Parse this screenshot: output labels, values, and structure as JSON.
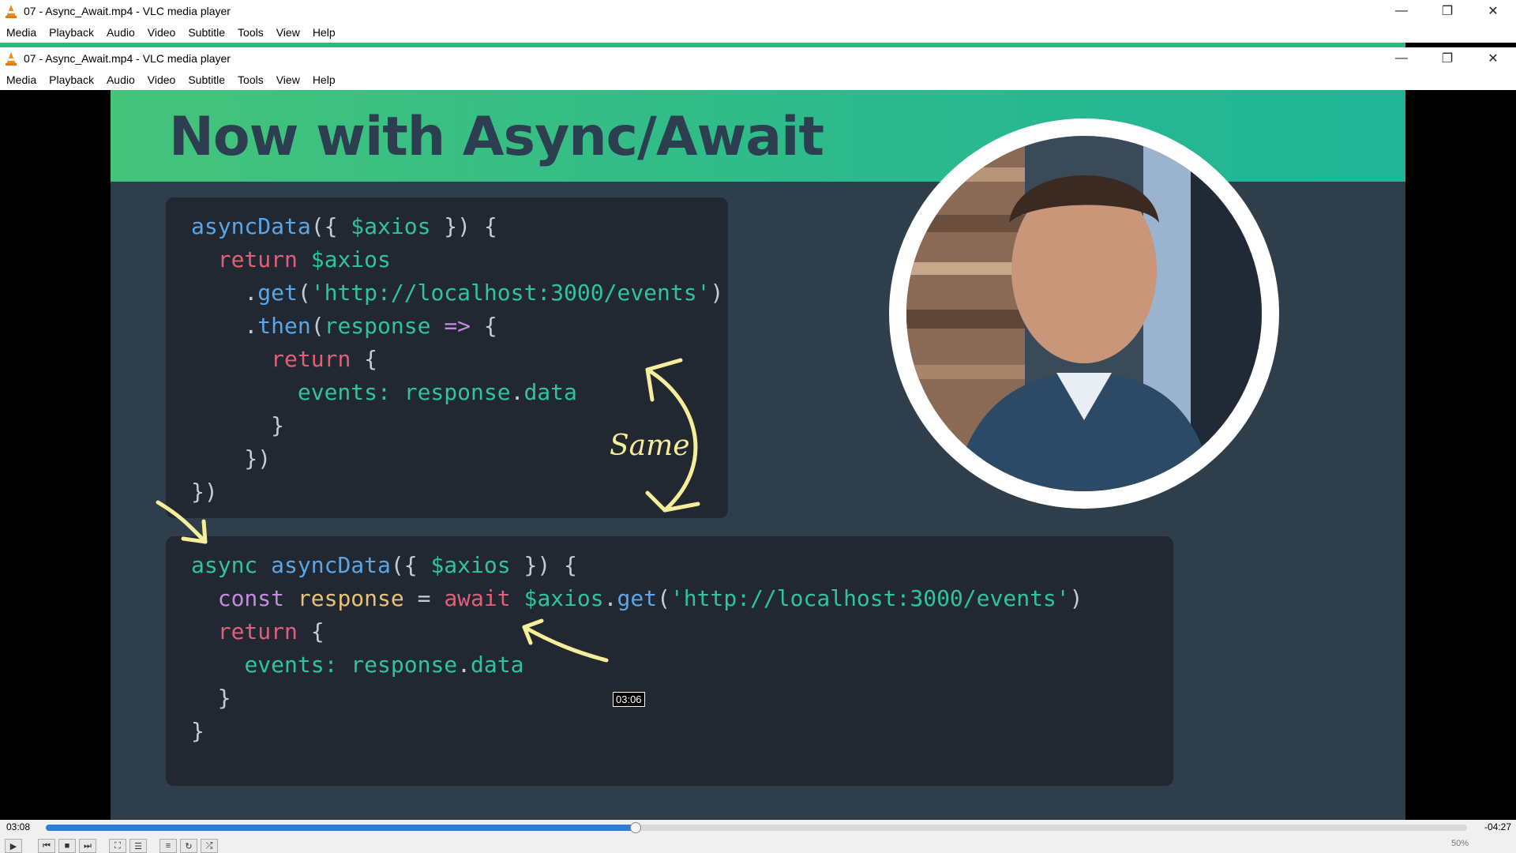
{
  "outer_window": {
    "title": "07 - Async_Await.mp4 - VLC media player",
    "menu": [
      "Media",
      "Playback",
      "Audio",
      "Video",
      "Subtitle",
      "Tools",
      "View",
      "Help"
    ]
  },
  "inner_window": {
    "title": "07 - Async_Await.mp4 - VLC media player",
    "menu": [
      "Media",
      "Playback",
      "Audio",
      "Video",
      "Subtitle",
      "Tools",
      "View",
      "Help"
    ]
  },
  "slide": {
    "title": "Now with Async/Await",
    "annotation": "Same"
  },
  "player": {
    "elapsed": "03:08",
    "remaining": "-04:27",
    "hover_time": "03:06",
    "progress_fraction": 0.415,
    "volume": "50%"
  },
  "colors": {
    "accent": "#2e7cd6",
    "header_green": "#35b67c"
  }
}
